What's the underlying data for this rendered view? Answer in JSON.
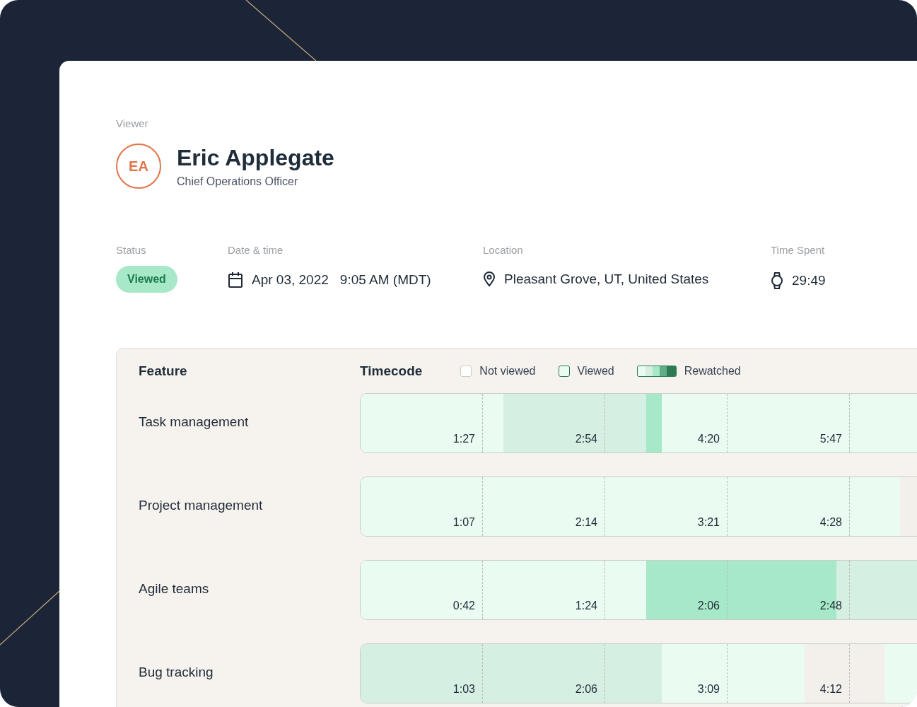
{
  "viewer": {
    "label": "Viewer",
    "initials": "EA",
    "name": "Eric Applegate",
    "title": "Chief Operations Officer"
  },
  "status": {
    "label": "Status",
    "value": "Viewed"
  },
  "date_time": {
    "label": "Date & time",
    "date": "Apr 03, 2022",
    "time": "9:05 AM (MDT)"
  },
  "location": {
    "label": "Location",
    "value": "Pleasant Grove, UT, United States"
  },
  "time_spent": {
    "label": "Time Spent",
    "value": "29:49"
  },
  "table": {
    "columns": [
      "Feature",
      "Timecode"
    ],
    "legend": [
      {
        "label": "Not viewed",
        "kind": "not_viewed"
      },
      {
        "label": "Viewed",
        "kind": "viewed"
      },
      {
        "label": "Rewatched",
        "kind": "rewatched"
      }
    ],
    "rows": [
      {
        "feature": "Task management",
        "ticks": [
          "1:27",
          "2:54",
          "4:20",
          "5:47"
        ],
        "cells": [
          {
            "kind": "viewed"
          },
          {
            "kind": "viewed"
          },
          {
            "kind": "viewed"
          },
          {
            "kind": "viewed"
          },
          {
            "kind": "viewed"
          },
          {
            "kind": "viewed"
          },
          {
            "kind": "viewed"
          },
          {
            "kind": "viewed"
          },
          {
            "kind": "viewed"
          },
          {
            "kind": "rewatched_1"
          },
          {
            "kind": "rewatched_1"
          },
          {
            "kind": "rewatched_1"
          },
          {
            "kind": "rewatched_1"
          },
          {
            "kind": "rewatched_1"
          },
          {
            "kind": "rewatched_1"
          },
          {
            "kind": "rewatched_1"
          },
          {
            "kind": "rewatched_1"
          },
          {
            "kind": "rewatched_1"
          },
          {
            "kind": "rewatched_2"
          },
          {
            "kind": "viewed"
          },
          {
            "kind": "viewed"
          },
          {
            "kind": "viewed"
          },
          {
            "kind": "viewed"
          },
          {
            "kind": "viewed"
          },
          {
            "kind": "viewed"
          },
          {
            "kind": "viewed"
          },
          {
            "kind": "viewed"
          },
          {
            "kind": "viewed"
          },
          {
            "kind": "viewed"
          },
          {
            "kind": "viewed"
          },
          {
            "kind": "viewed"
          },
          {
            "kind": "viewed"
          },
          {
            "kind": "viewed"
          },
          {
            "kind": "viewed"
          },
          {
            "kind": "viewed"
          },
          {
            "kind": "viewed"
          }
        ]
      },
      {
        "feature": "Project management",
        "ticks": [
          "1:07",
          "2:14",
          "3:21",
          "4:28"
        ],
        "cells": [
          {
            "kind": "viewed"
          },
          {
            "kind": "viewed"
          },
          {
            "kind": "viewed"
          },
          {
            "kind": "viewed"
          },
          {
            "kind": "viewed"
          },
          {
            "kind": "viewed"
          },
          {
            "kind": "viewed"
          },
          {
            "kind": "viewed"
          },
          {
            "kind": "viewed"
          },
          {
            "kind": "viewed"
          },
          {
            "kind": "viewed"
          },
          {
            "kind": "viewed"
          },
          {
            "kind": "viewed"
          },
          {
            "kind": "viewed"
          },
          {
            "kind": "viewed"
          },
          {
            "kind": "viewed"
          },
          {
            "kind": "viewed"
          },
          {
            "kind": "viewed"
          },
          {
            "kind": "viewed"
          },
          {
            "kind": "viewed"
          },
          {
            "kind": "viewed"
          },
          {
            "kind": "viewed"
          },
          {
            "kind": "viewed"
          },
          {
            "kind": "viewed"
          },
          {
            "kind": "viewed"
          },
          {
            "kind": "viewed"
          },
          {
            "kind": "viewed"
          },
          {
            "kind": "viewed"
          },
          {
            "kind": "viewed"
          },
          {
            "kind": "viewed"
          },
          {
            "kind": "viewed"
          },
          {
            "kind": "viewed"
          },
          {
            "kind": "viewed"
          },
          {
            "kind": "viewed"
          },
          {
            "kind": "not_viewed"
          },
          {
            "kind": "not_viewed"
          }
        ]
      },
      {
        "feature": "Agile teams",
        "ticks": [
          "0:42",
          "1:24",
          "2:06",
          "2:48"
        ],
        "cells": [
          {
            "kind": "viewed"
          },
          {
            "kind": "viewed"
          },
          {
            "kind": "viewed"
          },
          {
            "kind": "viewed"
          },
          {
            "kind": "viewed"
          },
          {
            "kind": "viewed"
          },
          {
            "kind": "viewed"
          },
          {
            "kind": "viewed"
          },
          {
            "kind": "viewed"
          },
          {
            "kind": "viewed"
          },
          {
            "kind": "viewed"
          },
          {
            "kind": "viewed"
          },
          {
            "kind": "viewed"
          },
          {
            "kind": "viewed"
          },
          {
            "kind": "viewed"
          },
          {
            "kind": "viewed"
          },
          {
            "kind": "viewed"
          },
          {
            "kind": "viewed"
          },
          {
            "kind": "rewatched_2"
          },
          {
            "kind": "rewatched_2"
          },
          {
            "kind": "rewatched_2"
          },
          {
            "kind": "rewatched_2"
          },
          {
            "kind": "rewatched_2"
          },
          {
            "kind": "rewatched_2"
          },
          {
            "kind": "rewatched_2"
          },
          {
            "kind": "rewatched_2"
          },
          {
            "kind": "rewatched_2"
          },
          {
            "kind": "rewatched_2"
          },
          {
            "kind": "rewatched_2"
          },
          {
            "kind": "rewatched_2"
          },
          {
            "kind": "rewatched_1"
          },
          {
            "kind": "rewatched_1"
          },
          {
            "kind": "rewatched_1"
          },
          {
            "kind": "rewatched_1"
          },
          {
            "kind": "rewatched_1"
          },
          {
            "kind": "rewatched_1"
          }
        ]
      },
      {
        "feature": "Bug tracking",
        "ticks": [
          "1:03",
          "2:06",
          "3:09",
          "4:12"
        ],
        "cells": [
          {
            "kind": "rewatched_1"
          },
          {
            "kind": "rewatched_1"
          },
          {
            "kind": "rewatched_1"
          },
          {
            "kind": "rewatched_1"
          },
          {
            "kind": "rewatched_1"
          },
          {
            "kind": "rewatched_1"
          },
          {
            "kind": "rewatched_1"
          },
          {
            "kind": "rewatched_1"
          },
          {
            "kind": "rewatched_1"
          },
          {
            "kind": "rewatched_1"
          },
          {
            "kind": "rewatched_1"
          },
          {
            "kind": "rewatched_1"
          },
          {
            "kind": "rewatched_1"
          },
          {
            "kind": "rewatched_1"
          },
          {
            "kind": "rewatched_1"
          },
          {
            "kind": "rewatched_1"
          },
          {
            "kind": "rewatched_1"
          },
          {
            "kind": "rewatched_1"
          },
          {
            "kind": "rewatched_1"
          },
          {
            "kind": "viewed"
          },
          {
            "kind": "viewed"
          },
          {
            "kind": "viewed"
          },
          {
            "kind": "viewed"
          },
          {
            "kind": "viewed"
          },
          {
            "kind": "viewed"
          },
          {
            "kind": "viewed"
          },
          {
            "kind": "viewed"
          },
          {
            "kind": "viewed"
          },
          {
            "kind": "not_viewed"
          },
          {
            "kind": "not_viewed"
          },
          {
            "kind": "not_viewed"
          },
          {
            "kind": "not_viewed"
          },
          {
            "kind": "not_viewed"
          },
          {
            "kind": "viewed"
          },
          {
            "kind": "viewed"
          },
          {
            "kind": "viewed"
          }
        ]
      }
    ]
  }
}
